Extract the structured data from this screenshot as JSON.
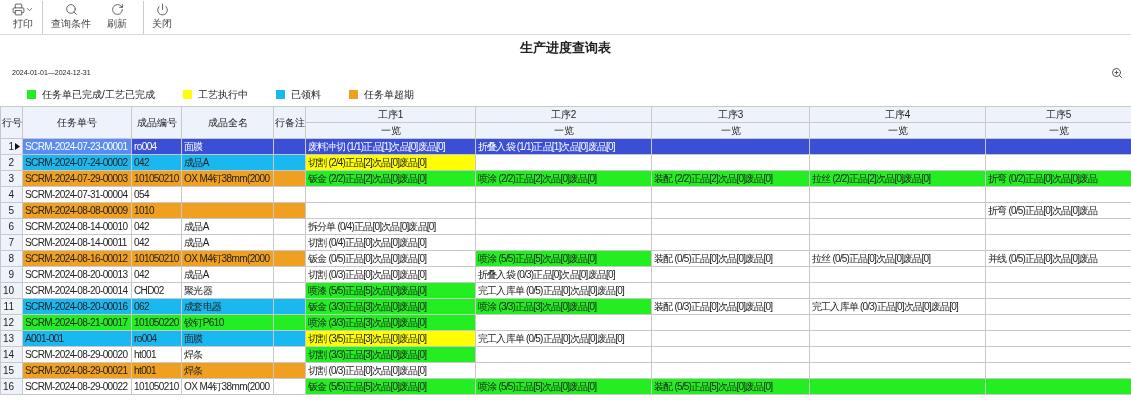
{
  "toolbar": [
    {
      "kind": "print",
      "label": "打印",
      "has_menu": true
    },
    {
      "kind": "search",
      "label": "查询条件",
      "has_menu": false
    },
    {
      "kind": "refresh",
      "label": "刷新",
      "has_menu": false
    },
    {
      "kind": "power",
      "label": "关闭",
      "has_menu": false
    }
  ],
  "title": "生产进度查询表",
  "date_range": "2024-01-01—2024-12-31",
  "legend": [
    {
      "label": "任务单已完成/工艺已完成",
      "color": "#22ee22"
    },
    {
      "label": "工艺执行中",
      "color": "#ffff00"
    },
    {
      "label": "已领料",
      "color": "#1ab8f0"
    },
    {
      "label": "任务单超期",
      "color": "#f0a020"
    }
  ],
  "columns": [
    "行号",
    "任务单号",
    "成品编号",
    "成品全名",
    "行备注"
  ],
  "processes": [
    {
      "name": "工序1",
      "sub": "一览"
    },
    {
      "name": "工序2",
      "sub": "一览"
    },
    {
      "name": "工序3",
      "sub": "一览"
    },
    {
      "name": "工序4",
      "sub": "一览"
    },
    {
      "name": "工序5",
      "sub": "一览"
    }
  ],
  "rows": [
    {
      "no": "1",
      "selected": true,
      "color": "#3b4fd6",
      "task": "SCRM-2024-07-23-00001",
      "code": "ro004",
      "name": "面膜",
      "process_1": {
        "text": "废料冲切 (1/1)正品[1]次品[0]废品[0]",
        "color": "#3b4fd6"
      },
      "process_2": {
        "text": "折叠入袋 (1/1)正品[1]次品[0]废品[0]",
        "color": "#3b4fd6"
      },
      "process_3": {
        "color": "#3b4fd6"
      },
      "process_4": {
        "color": "#3b4fd6"
      },
      "process_5": {
        "color": "#3b4fd6"
      }
    },
    {
      "no": "2",
      "selected": false,
      "color": "#1ab8f0",
      "task": "SCRM-2024-07-24-00002",
      "code": "042",
      "name": "成品A",
      "process_1": {
        "text": "切割 (2/4)正品[2]次品[0]废品[0]",
        "color": "#ffff00"
      }
    },
    {
      "no": "3",
      "selected": false,
      "color": "#f0a020",
      "task": "SCRM-2024-07-29-00003",
      "code": "101050210",
      "name": "OX M4钉38mm(2000",
      "process_1": {
        "text": "钣金 (2/2)正品[2]次品[0]废品[0]",
        "color": "#22ee22"
      },
      "process_2": {
        "text": "喷涂 (2/2)正品[2]次品[0]废品[0]",
        "color": "#22ee22"
      },
      "process_3": {
        "text": "装配 (2/2)正品[2]次品[0]废品[0]",
        "color": "#22ee22"
      },
      "process_4": {
        "text": "拉丝 (2/2)正品[2]次品[0]废品[0]",
        "color": "#22ee22"
      },
      "process_5": {
        "text": "折弯 (0/2)正品[0]次品[0]废品",
        "color": "#22ee22"
      }
    },
    {
      "no": "4",
      "selected": false,
      "task": "SCRM-2024-07-31-00004",
      "code": "054"
    },
    {
      "no": "5",
      "selected": false,
      "color": "#f0a020",
      "task": "SCRM-2024-08-08-00009",
      "code": "1010",
      "process_5": {
        "text": "折弯 (0/5)正品[0]次品[0]废品"
      }
    },
    {
      "no": "6",
      "selected": false,
      "task": "SCRM-2024-08-14-00010",
      "code": "042",
      "name": "成品A",
      "process_1": {
        "text": "拆分单 (0/4)正品[0]次品[0]废品[0]"
      }
    },
    {
      "no": "7",
      "selected": false,
      "task": "SCRM-2024-08-14-00011",
      "code": "042",
      "name": "成品A",
      "process_1": {
        "text": "切割 (0/4)正品[0]次品[0]废品[0]"
      }
    },
    {
      "no": "8",
      "selected": false,
      "color": "#f0a020",
      "task": "SCRM-2024-08-16-00012",
      "code": "101050210",
      "name": "OX M4钉38mm(2000",
      "process_1": {
        "text": "钣金 (0/5)正品[0]次品[0]废品[0]"
      },
      "process_2": {
        "text": "喷涂 (5/5)正品[5]次品[0]废品[0]",
        "color": "#22ee22"
      },
      "process_3": {
        "text": "装配 (0/5)正品[0]次品[0]废品[0]"
      },
      "process_4": {
        "text": "拉丝 (0/5)正品[0]次品[0]废品[0]"
      },
      "process_5": {
        "text": "并线 (0/5)正品[0]次品[0]废品"
      }
    },
    {
      "no": "9",
      "selected": false,
      "task": "SCRM-2024-08-20-00013",
      "code": "042",
      "name": "成品A",
      "process_1": {
        "text": "切割 (0/3)正品[0]次品[0]废品[0]"
      },
      "process_2": {
        "text": "折叠入袋 (0/3)正品[0]次品[0]废品[0]"
      }
    },
    {
      "no": "10",
      "selected": false,
      "task": "SCRM-2024-08-20-00014",
      "code": "CHD02",
      "name": "聚光器",
      "process_1": {
        "text": "喷漆 (5/5)正品[5]次品[0]废品[0]",
        "color": "#22ee22"
      },
      "process_2": {
        "text": "完工入库单 (0/5)正品[0]次品[0]废品[0]"
      }
    },
    {
      "no": "11",
      "selected": false,
      "color": "#1ab8f0",
      "task": "SCRM-2024-08-20-00016",
      "code": "062",
      "name": "成套电器",
      "process_1": {
        "text": "钣金 (3/3)正品[3]次品[0]废品[0]",
        "color": "#22ee22"
      },
      "process_2": {
        "text": "喷涂 (3/3)正品[3]次品[0]废品[0]",
        "color": "#22ee22"
      },
      "process_3": {
        "text": "装配 (0/3)正品[0]次品[0]废品[0]"
      },
      "process_4": {
        "text": "完工入库单 (0/3)正品[0]次品[0]废品[0]"
      }
    },
    {
      "no": "12",
      "selected": false,
      "color": "#22ee22",
      "task": "SCRM-2024-08-21-00017",
      "code": "101050220",
      "name": "铰钉P610",
      "process_1": {
        "text": "喷涂 (3/3)正品[3]次品[0]废品[0]",
        "color": "#22ee22"
      }
    },
    {
      "no": "13",
      "selected": false,
      "color": "#1ab8f0",
      "task": "A001-001",
      "code": "ro004",
      "name": "面膜",
      "process_1": {
        "text": "切割 (3/5)正品[3]次品[0]废品[0]",
        "color": "#ffff00"
      },
      "process_2": {
        "text": "完工入库单 (0/5)正品[0]次品[0]废品[0]"
      }
    },
    {
      "no": "14",
      "selected": false,
      "task": "SCRM-2024-08-29-00020",
      "code": "ht001",
      "name": "焊条",
      "process_1": {
        "text": "切割 (3/3)正品[3]次品[0]废品[0]",
        "color": "#22ee22"
      }
    },
    {
      "no": "15",
      "selected": false,
      "color": "#f0a020",
      "task": "SCRM-2024-08-29-00021",
      "code": "ht001",
      "name": "焊条",
      "process_1": {
        "text": "切割 (0/3)正品[0]次品[0]废品[0]"
      }
    },
    {
      "no": "16",
      "selected": false,
      "task": "SCRM-2024-08-29-00022",
      "code": "101050210",
      "name": "OX M4钉38mm(2000",
      "process_1": {
        "text": "钣金 (5/5)正品[5]次品[0]废品[0]",
        "color": "#22ee22"
      },
      "process_2": {
        "text": "喷涂 (5/5)正品[5]次品[0]废品[0]",
        "color": "#22ee22"
      },
      "process_3": {
        "text": "装配 (5/5)正品[5]次品[0]废品[0]",
        "color": "#22ee22"
      },
      "process_4": {
        "color": "#22ee22"
      },
      "process_5": {
        "color": "#22ee22"
      }
    }
  ]
}
